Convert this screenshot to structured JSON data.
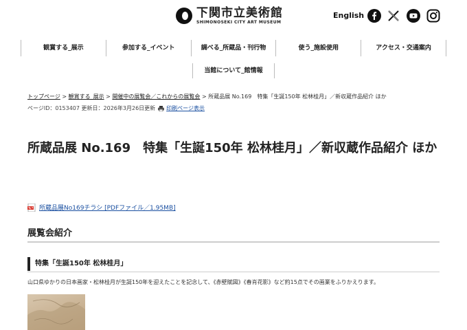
{
  "header": {
    "logo_title": "下関市立美術館",
    "logo_subtitle": "SHIMONOSEKI CITY ART MUSEUM",
    "lang_label": "English",
    "social": [
      "facebook-icon",
      "x-icon",
      "youtube-icon",
      "instagram-icon"
    ]
  },
  "nav": {
    "items": [
      {
        "label": "観賞する_展示"
      },
      {
        "label": "参加する_イベント"
      },
      {
        "label": "調べる_所蔵品・刊行物"
      },
      {
        "label": "使う_施設使用"
      },
      {
        "label": "アクセス・交通案内"
      }
    ],
    "second_row": "当館について_館情報"
  },
  "breadcrumb": {
    "items": [
      "トップページ",
      "観賞する_展示",
      "開催中の展覧会／これからの展覧会"
    ],
    "separator": " > ",
    "current": "所蔵品展 No.169　特集「生誕150年 松林桂月」／新収蔵作品紹介 ほか"
  },
  "meta": {
    "page_id": "ページID：0153407 更新日：2026年3月26日更新",
    "print_link": "印刷ページ表示"
  },
  "page_title": "所蔵品展 No.169　特集「生誕150年 松林桂月」／新収蔵作品紹介 ほか",
  "pdf": {
    "icon": "pdf-icon",
    "link": "所蔵品展No169チラシ [PDFファイル／1.95MB]"
  },
  "section": {
    "heading": "展覧会紹介",
    "sub_heading": "特集「生誕150年 松林桂月」",
    "description": "山口県ゆかりの日本画家・松林桂月が生誕150年を迎えたことを記念して、《赤壁賦図》《春肖花影》など約15点でその画業をふりかえります。"
  },
  "colors": {
    "link": "#1a4fa0",
    "text": "#222222",
    "rule": "#cccccc",
    "pdf_red": "#d9342b"
  }
}
